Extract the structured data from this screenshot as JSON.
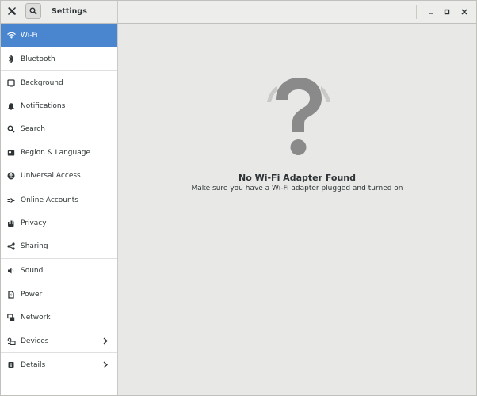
{
  "app": {
    "title": "Settings"
  },
  "window_controls": {
    "minimize": "minimize-icon",
    "maximize": "maximize-icon",
    "close": "close-icon"
  },
  "sidebar": {
    "items": [
      {
        "label": "Wi-Fi",
        "icon": "wifi-icon",
        "selected": true
      },
      {
        "label": "Bluetooth",
        "icon": "bluetooth-icon"
      },
      {
        "label": "Background",
        "icon": "background-icon"
      },
      {
        "label": "Notifications",
        "icon": "bell-icon"
      },
      {
        "label": "Search",
        "icon": "search-icon"
      },
      {
        "label": "Region & Language",
        "icon": "region-icon"
      },
      {
        "label": "Universal Access",
        "icon": "accessibility-icon"
      },
      {
        "label": "Online Accounts",
        "icon": "online-accounts-icon"
      },
      {
        "label": "Privacy",
        "icon": "privacy-icon"
      },
      {
        "label": "Sharing",
        "icon": "share-icon"
      },
      {
        "label": "Sound",
        "icon": "speaker-icon"
      },
      {
        "label": "Power",
        "icon": "power-icon"
      },
      {
        "label": "Network",
        "icon": "network-icon"
      },
      {
        "label": "Devices",
        "icon": "devices-icon",
        "has_submenu": true
      },
      {
        "label": "Details",
        "icon": "info-icon",
        "has_submenu": true
      }
    ]
  },
  "main": {
    "title": "No Wi-Fi Adapter Found",
    "subtitle": "Make sure you have a Wi-Fi adapter plugged and turned on",
    "icon": "question-mark-icon"
  },
  "colors": {
    "accent": "#4a86cf",
    "main_bg": "#e8e8e7",
    "icon_gray": "#8a8a8a"
  }
}
